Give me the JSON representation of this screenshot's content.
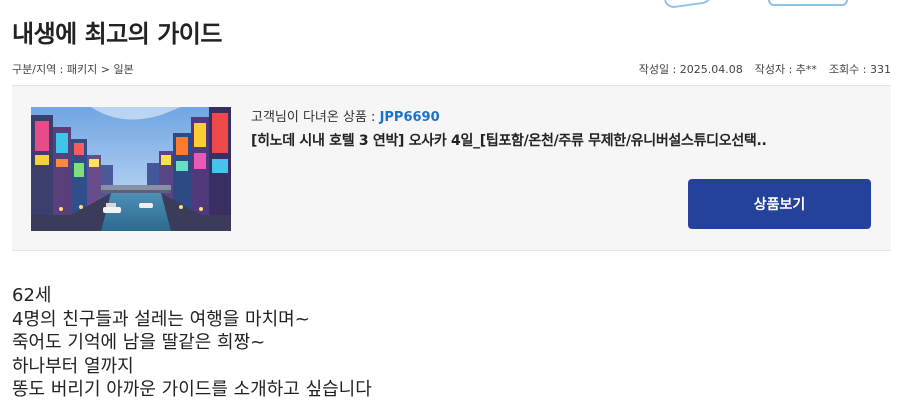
{
  "post": {
    "title": "내생에 최고의 가이드",
    "breadcrumb": "구분/지역 : 패키지 > 일본",
    "date": "작성일 : 2025.04.08",
    "author": "작성자 : 추**",
    "views": "조회수 : 331"
  },
  "product": {
    "code_label": "고객님이 다녀온 상품 : ",
    "code": "JPP6690",
    "name": "[히노데 시내 호텔 3 연박] 오사카 4일_[팁포함/온천/주류 무제한/유니버설스튜디오선택..",
    "button_label": "상품보기",
    "image_alt": "오사카 도톤보리 야경",
    "accent_color": "#25429a",
    "code_color": "#1a73c9"
  },
  "content": {
    "lines": [
      "62세",
      "4명의 친구들과 설레는 여행을 마치며~",
      "죽어도 기억에 남을 딸같은 희짱~",
      "하나부터 열까지",
      "똥도 버리기 아까운 가이드를 소개하고 싶습니다"
    ]
  }
}
